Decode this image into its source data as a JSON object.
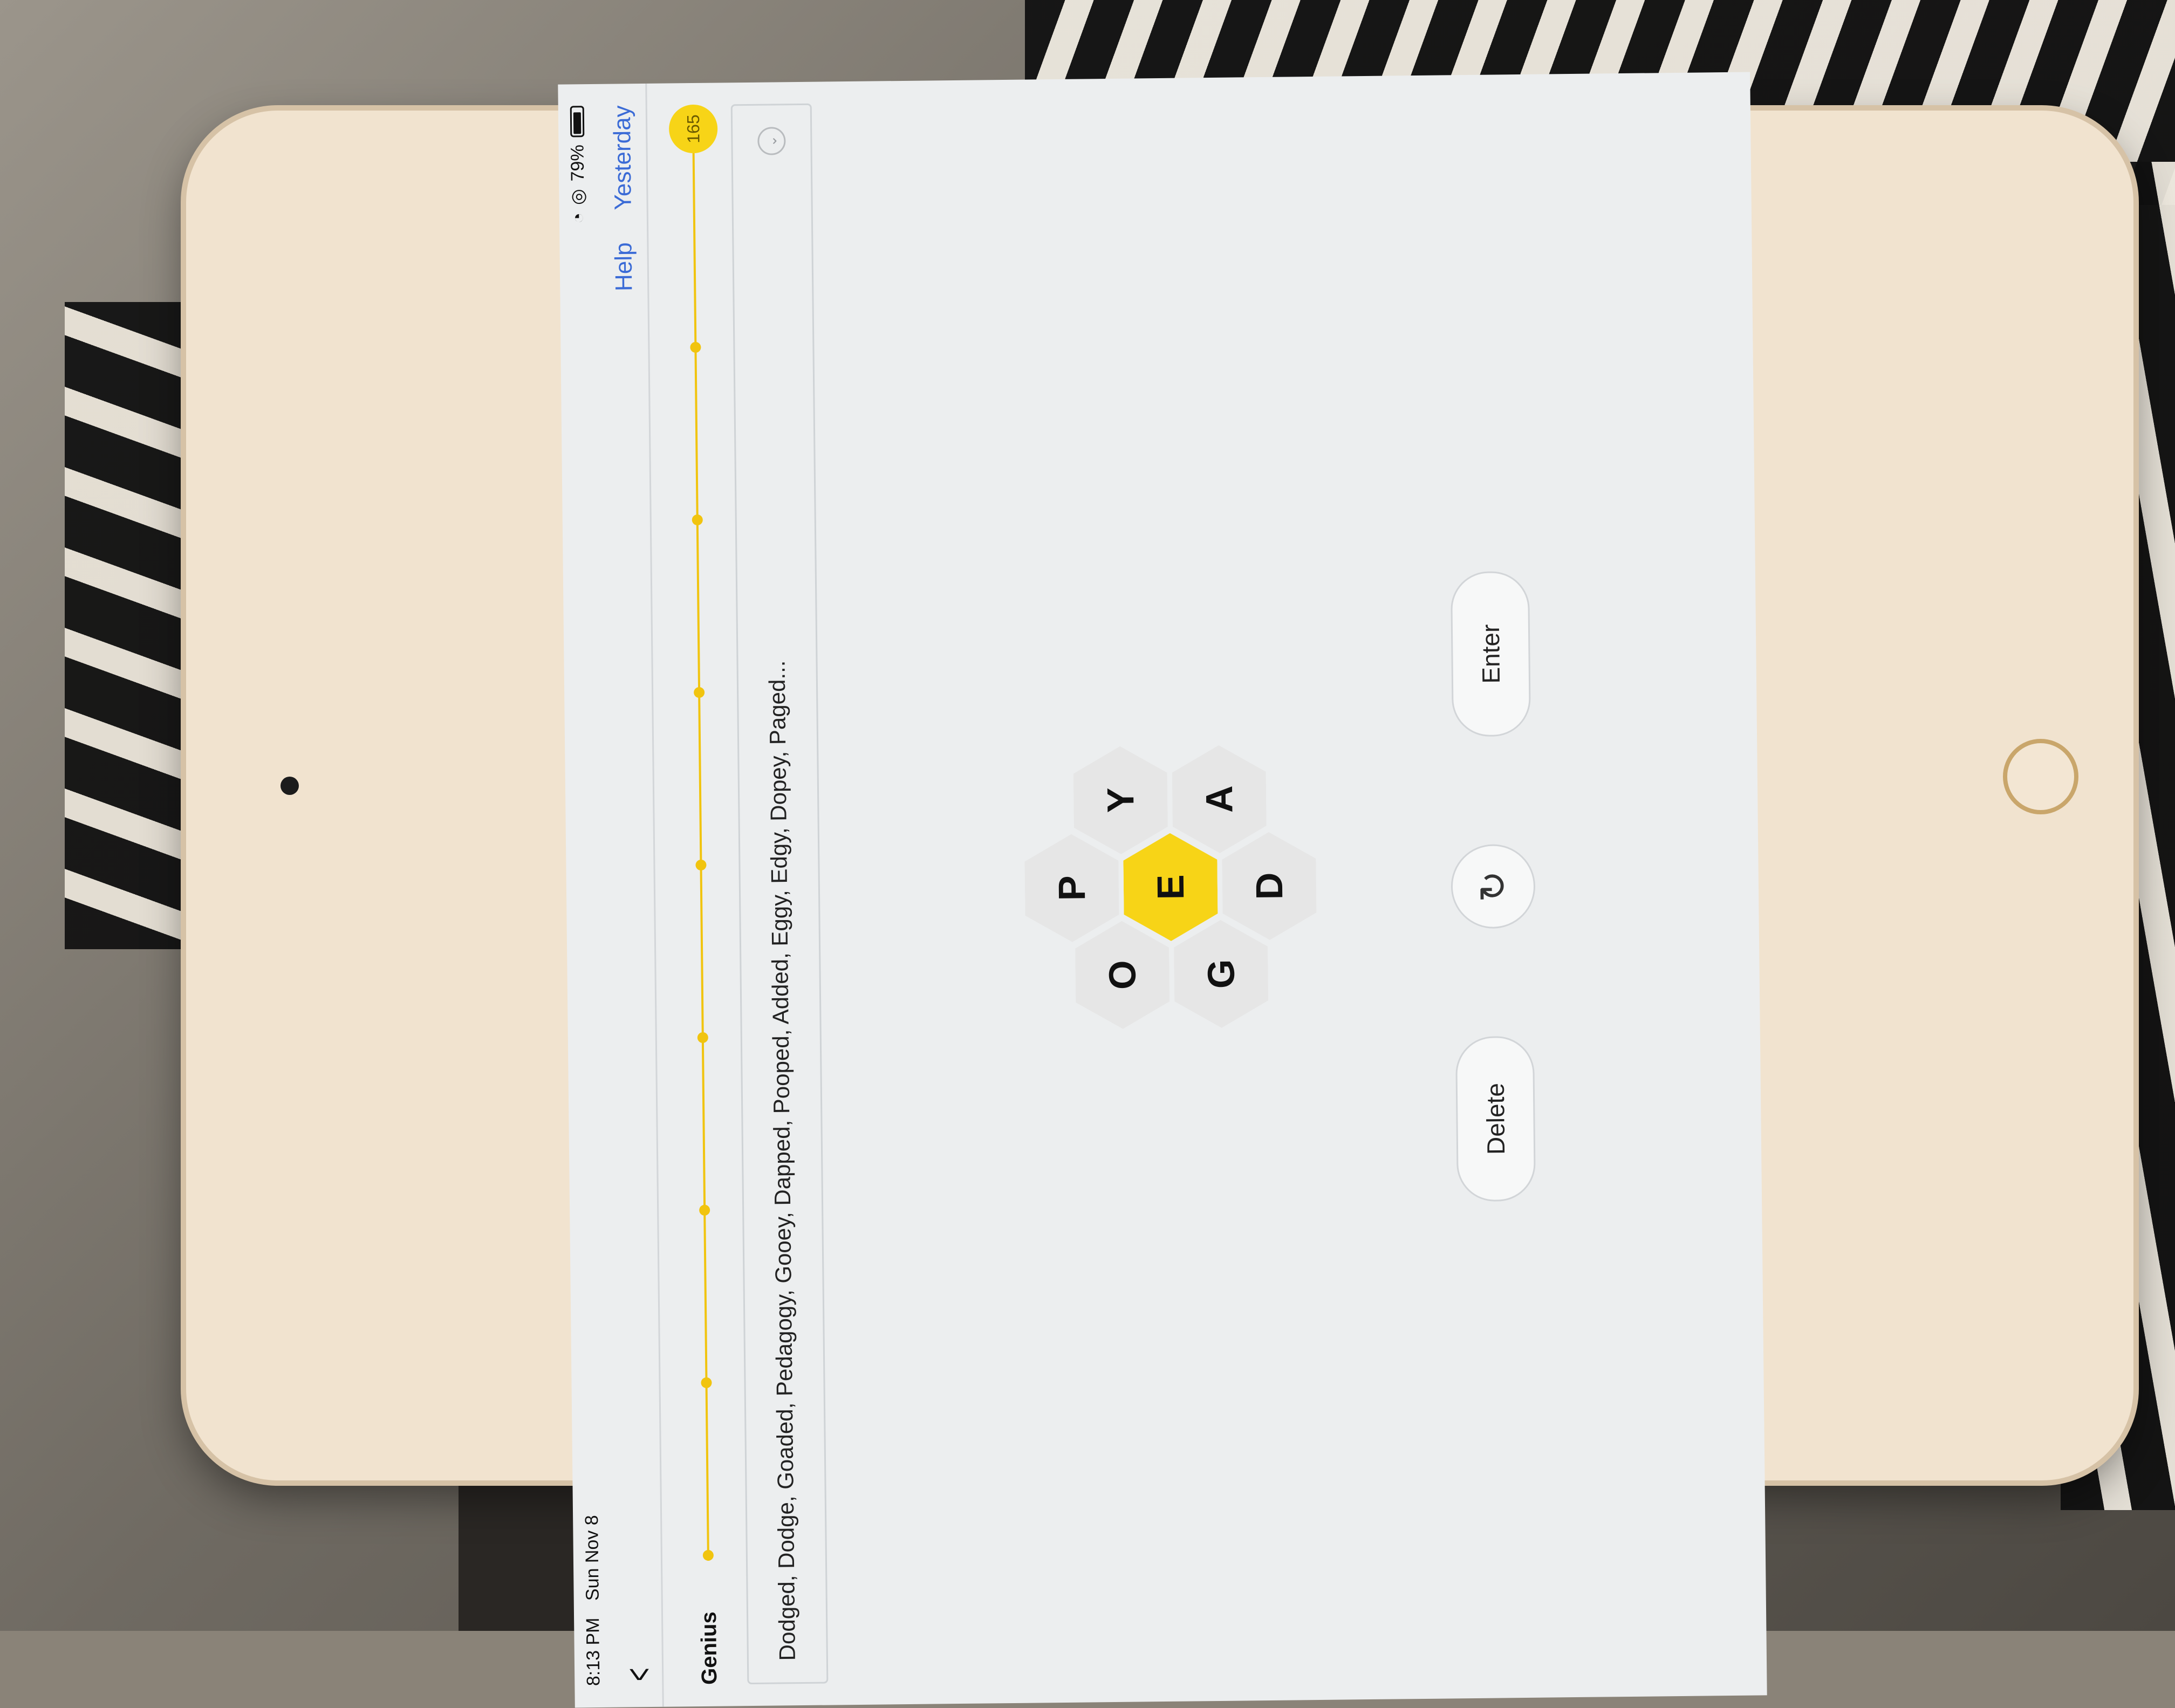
{
  "status_bar": {
    "time": "8:13 PM",
    "date": "Sun Nov 8",
    "battery": "79%"
  },
  "nav": {
    "help": "Help",
    "yesterday": "Yesterday"
  },
  "rank": {
    "label": "Genius",
    "score": "165",
    "milestones": 9
  },
  "found_words": "Dodged, Dodge, Goaded, Pedagogy, Gooey, Dapped, Pooped, Added, Eggy, Edgy, Dopey, Paged...",
  "letters": {
    "center": "E",
    "outer": [
      "P",
      "Y",
      "A",
      "D",
      "G",
      "O"
    ]
  },
  "buttons": {
    "delete": "Delete",
    "enter": "Enter"
  },
  "colors": {
    "accent": "#f7d417",
    "link": "#3b6bd6"
  }
}
